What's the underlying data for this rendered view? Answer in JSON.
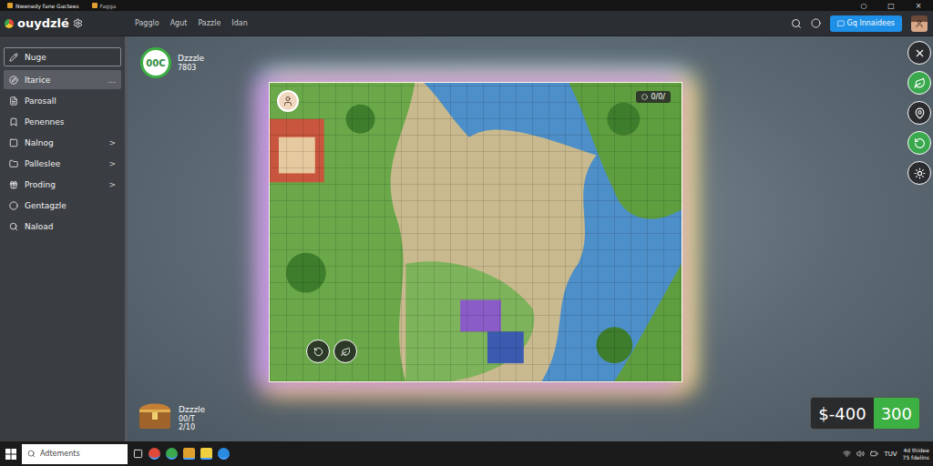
{
  "browser": {
    "tabs": [
      {
        "title": "Nwenedy fane Gactees",
        "selected": true
      },
      {
        "title": "Fagga",
        "selected": false
      }
    ],
    "window_controls": [
      "○",
      "□",
      "×"
    ]
  },
  "header": {
    "logo": "ouydzlé",
    "nav": [
      "Pagglo",
      "Agut",
      "Pazzle",
      "Idan"
    ],
    "action_button": "Gq lnnaidees"
  },
  "sidebar": {
    "items": [
      {
        "label": "Nuge",
        "kind": "field",
        "selected": false,
        "suffix": ""
      },
      {
        "label": "Itarice",
        "kind": "item",
        "selected": true,
        "suffix": "..."
      },
      {
        "label": "Parosall",
        "kind": "item",
        "selected": false,
        "suffix": ""
      },
      {
        "label": "Penennes",
        "kind": "item",
        "selected": false,
        "suffix": ""
      },
      {
        "label": "Nalnog",
        "kind": "item",
        "selected": false,
        "suffix": ">"
      },
      {
        "label": "Palleslee",
        "kind": "item",
        "selected": false,
        "suffix": ">"
      },
      {
        "label": "Proding",
        "kind": "item",
        "selected": false,
        "suffix": ">"
      },
      {
        "label": "Gentagzle",
        "kind": "item",
        "selected": false,
        "suffix": ""
      },
      {
        "label": "Naload",
        "kind": "item",
        "selected": false,
        "suffix": ""
      }
    ]
  },
  "hud": {
    "timer": {
      "value": "00C",
      "title": "Dzzzle",
      "count": "7803"
    },
    "piece_counter": "0/0/",
    "tools": [
      {
        "active": false
      },
      {
        "active": true
      },
      {
        "active": false
      },
      {
        "active": true
      },
      {
        "active": false
      }
    ],
    "inventory": {
      "title": "Dzzzle",
      "lines": [
        "00/T",
        "2/10"
      ]
    },
    "score": {
      "cost": "$-400",
      "points": "300"
    }
  },
  "taskbar": {
    "search_placeholder": "Adtements",
    "tray_label": "TUV",
    "clock": [
      "4d thidee",
      "75 fdelins"
    ]
  }
}
